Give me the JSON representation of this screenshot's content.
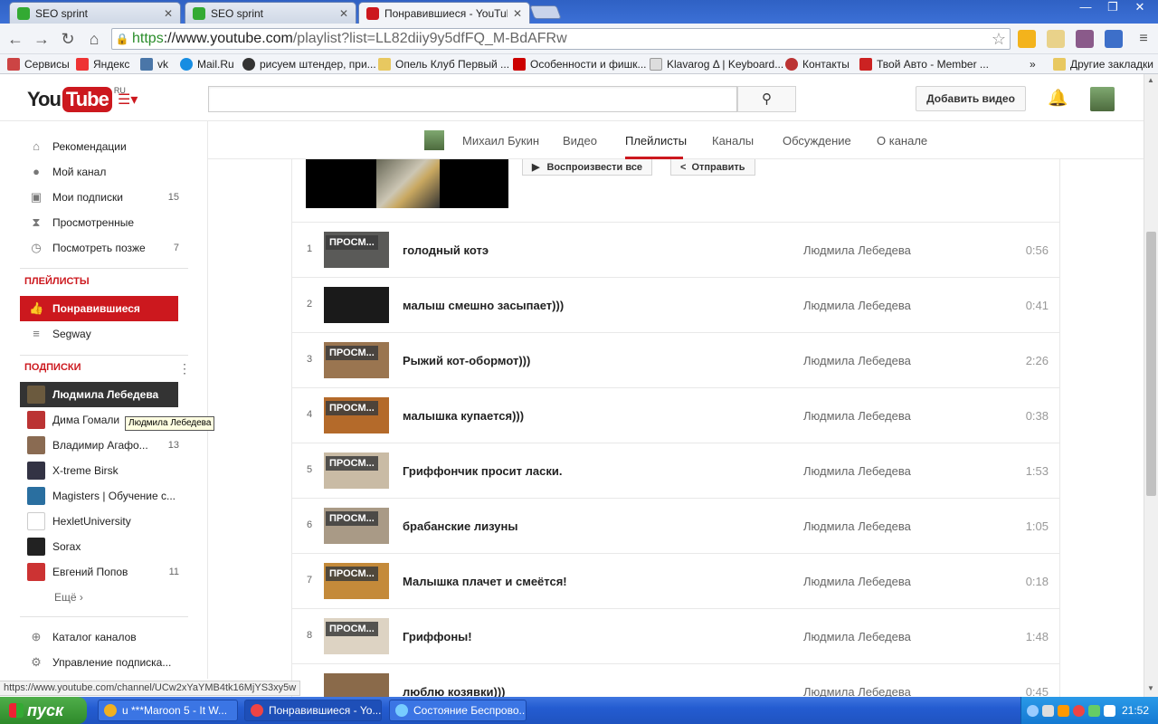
{
  "browser": {
    "tabs": [
      {
        "title": "SEO sprint",
        "active": false
      },
      {
        "title": "SEO sprint",
        "active": false
      },
      {
        "title": "Понравившиеся - YouTube",
        "active": true
      }
    ],
    "url_scheme": "https",
    "url_host": "://www.youtube.com",
    "url_path": "/playlist?list=LL82diiy9y5dfFQ_M-BdAFRw",
    "bookmarks": [
      "Сервисы",
      "Яндекс",
      "vk",
      "Mail.Ru",
      "рисуем штендер, при...",
      "Опель Клуб Первый ...",
      "Особенности и фишк...",
      "Klavarog Δ | Keyboard...",
      "Контакты",
      "Твой Авто - Member ..."
    ],
    "bookmarks_more": "»",
    "other_bookmarks": "Другие закладки",
    "status_url": "https://www.youtube.com/channel/UCw2xYaYMB4tk16MjYS3xy5w"
  },
  "yt": {
    "logo_you": "You",
    "logo_tube": "Tube",
    "logo_region": "RU",
    "search_icon": "⚲",
    "add_video": "Добавить видео"
  },
  "sidebar": {
    "nav": [
      {
        "label": "Рекомендации",
        "icon": "home-icon",
        "count": ""
      },
      {
        "label": "Мой канал",
        "icon": "user-icon",
        "count": ""
      },
      {
        "label": "Мои подписки",
        "icon": "subscriptions-icon",
        "count": "15"
      },
      {
        "label": "Просмотренные",
        "icon": "hourglass-icon",
        "count": ""
      },
      {
        "label": "Посмотреть позже",
        "icon": "clock-icon",
        "count": "7"
      }
    ],
    "playlists_heading": "ПЛЕЙЛИСТЫ",
    "playlists": [
      {
        "label": "Понравившиеся",
        "icon": "thumbs-up-icon"
      },
      {
        "label": "Segway",
        "icon": "list-icon"
      }
    ],
    "subs_heading": "ПОДПИСКИ",
    "subs": [
      {
        "label": "Людмила Лебедева",
        "count": "",
        "color": "#6b5a3e"
      },
      {
        "label": "Дима Гомали",
        "count": "",
        "color": "#b33"
      },
      {
        "label": "Владимир Агафо...",
        "count": "13",
        "color": "#8a6b52"
      },
      {
        "label": "X-treme Birsk",
        "count": "",
        "color": "#334"
      },
      {
        "label": "Magisters | Обучение с...",
        "count": "",
        "color": "#2a6fa0"
      },
      {
        "label": "HexletUniversity",
        "count": "",
        "color": "#ffffff"
      },
      {
        "label": "Sorax",
        "count": "",
        "color": "#222"
      },
      {
        "label": "Евгений Попов",
        "count": "11",
        "color": "#c33"
      }
    ],
    "more": "Ещё ›",
    "catalog": "Каталог каналов",
    "manage": "Управление подписка...",
    "tooltip": "Людмила Лебедева"
  },
  "channel_nav": {
    "owner": "Михаил Букин",
    "links": [
      "Видео",
      "Плейлисты",
      "Каналы",
      "Обсуждение",
      "О канале"
    ],
    "active": "Плейлисты"
  },
  "playlist": {
    "play_all": "Воспроизвести все",
    "share": "Отправить",
    "watched_label": "ПРОСМ...",
    "items": [
      {
        "index": "1",
        "title": "голодный котэ",
        "owner": "Людмила Лебедева",
        "duration": "0:56",
        "watched": true,
        "thumb_color": "#5a5a58"
      },
      {
        "index": "2",
        "title": "малыш смешно засыпает)))",
        "owner": "Людмила Лебедева",
        "duration": "0:41",
        "watched": false,
        "thumb_color": "#1a1a1a"
      },
      {
        "index": "3",
        "title": "Рыжий кот-обормот)))",
        "owner": "Людмила Лебедева",
        "duration": "2:26",
        "watched": true,
        "thumb_color": "#9a7550"
      },
      {
        "index": "4",
        "title": "малышка купается)))",
        "owner": "Людмила Лебедева",
        "duration": "0:38",
        "watched": true,
        "thumb_color": "#b46a2a"
      },
      {
        "index": "5",
        "title": "Гриффончик просит ласки.",
        "owner": "Людмила Лебедева",
        "duration": "1:53",
        "watched": true,
        "thumb_color": "#c9bba5"
      },
      {
        "index": "6",
        "title": "брабанские лизуны",
        "owner": "Людмила Лебедева",
        "duration": "1:05",
        "watched": true,
        "thumb_color": "#a99a86"
      },
      {
        "index": "7",
        "title": "Малышка плачет и смеётся!",
        "owner": "Людмила Лебедева",
        "duration": "0:18",
        "watched": true,
        "thumb_color": "#c48a3a"
      },
      {
        "index": "8",
        "title": "Гриффоны!",
        "owner": "Людмила Лебедева",
        "duration": "1:48",
        "watched": true,
        "thumb_color": "#ddd3c3"
      },
      {
        "index": "",
        "title": "люблю козявки)))",
        "owner": "Людмила Лебедева",
        "duration": "0:45",
        "watched": false,
        "thumb_color": "#8a6a4a"
      }
    ]
  },
  "taskbar": {
    "start": "пуск",
    "tasks": [
      {
        "label": "u ***Maroon 5 - It W...",
        "color": "#f0b020"
      },
      {
        "label": "Понравившиеся - Yo...",
        "color": "#e44"
      },
      {
        "label": "Состояние Беспрово...",
        "color": "#7cf"
      }
    ],
    "clock": "21:52"
  }
}
